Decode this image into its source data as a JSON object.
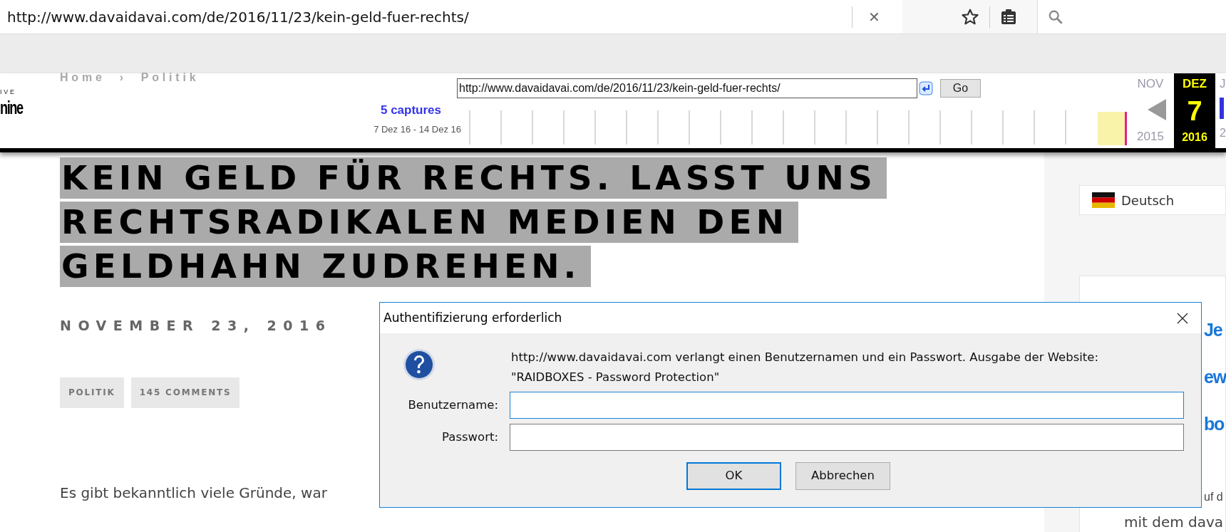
{
  "browser": {
    "url": "http://www.davaidavai.com/de/2016/11/23/kein-geld-fuer-rechts/",
    "clear_label": "✕"
  },
  "breadcrumb": {
    "home": "Home",
    "separator": "›",
    "current": "Politik"
  },
  "wayback": {
    "logo_top": "IVE",
    "logo_bottom": "nine",
    "url": "http://www.davaidavai.com/de/2016/11/23/kein-geld-fuer-rechts/",
    "go": "Go",
    "captures": "5 captures",
    "range": "7 Dez 16 - 14 Dez 16",
    "prev_month": "NOV",
    "prev_year": "2015",
    "current": {
      "month": "DEZ",
      "day": "7",
      "year": "2016"
    },
    "next_month": "J",
    "next_year": "2"
  },
  "article": {
    "title_lines": [
      "KEIN GELD FÜR RECHTS. LASST UNS",
      "RECHTSRADIKALEN MEDIEN DEN",
      "GELDHAHN ZUDREHEN."
    ],
    "date": "NOVEMBER 23, 2016",
    "tags": [
      "POLITIK",
      "145 COMMENTS"
    ],
    "intro": "Es gibt bekanntlich viele Gründe, war"
  },
  "sidebar": {
    "language": "Deutsch",
    "headline_fragments": [
      "Je",
      "ew",
      "bo"
    ],
    "text_fragments": [
      "uf d",
      "mit dem dava"
    ]
  },
  "dialog": {
    "title": "Authentifizierung erforderlich",
    "message": "http://www.davaidavai.com verlangt einen Benutzernamen und ein Passwort. Ausgabe der Website: \"RAIDBOXES - Password Protection\"",
    "fields": [
      {
        "label": "Benutzername:",
        "focused": true
      },
      {
        "label": "Passwort:",
        "focused": false
      }
    ],
    "buttons": [
      {
        "label": "OK",
        "default": true
      },
      {
        "label": "Abbrechen",
        "default": false
      }
    ]
  }
}
